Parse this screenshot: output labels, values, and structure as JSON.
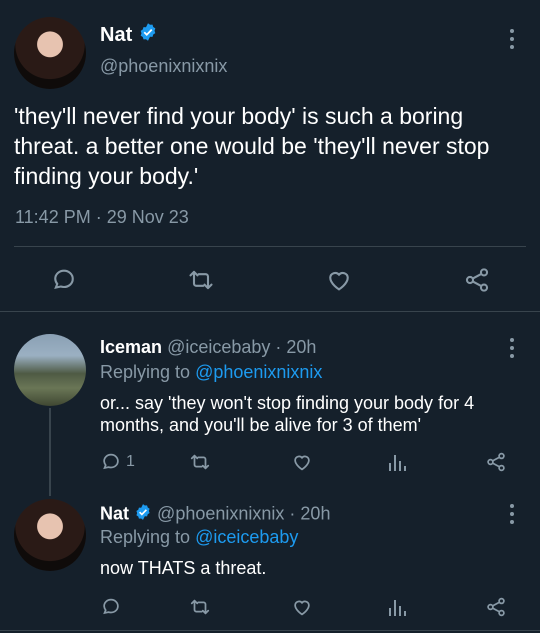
{
  "main_tweet": {
    "display_name": "Nat",
    "handle": "@phoenixnixnix",
    "text": "'they'll never find your body' is such a boring threat. a better one would be 'they'll never stop finding your body.'",
    "time": "11:42 PM",
    "separator": "·",
    "date": "29 Nov 23",
    "actions": [
      "reply-icon",
      "retweet-icon",
      "like-icon",
      "share-icon"
    ]
  },
  "reply_1": {
    "display_name": "Iceman",
    "handle": "@iceicebaby",
    "age": "· 20h",
    "replying_prefix": "Replying to",
    "replying_to": "@phoenixnixnix",
    "text": "or... say 'they won't stop finding your body for 4 months, and you'll be alive for 3 of them'",
    "reply_count": "1"
  },
  "reply_2": {
    "display_name": "Nat",
    "handle": "@phoenixnixnix",
    "age": "· 20h",
    "replying_prefix": "Replying to",
    "replying_to": "@iceicebaby",
    "text": "now THATS a threat."
  },
  "colors": {
    "background": "#15202b",
    "muted": "#8899a6",
    "accent": "#1d9bf0",
    "divider": "#38444d"
  }
}
